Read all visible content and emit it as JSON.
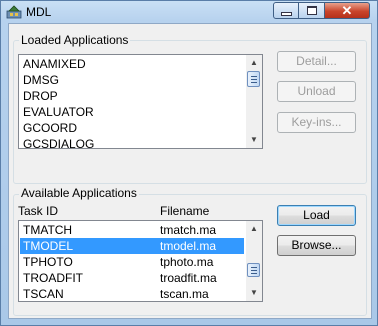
{
  "window": {
    "title": "MDL",
    "minimize_label": "",
    "maximize_label": "",
    "close_label": "✕"
  },
  "loaded": {
    "legend": "Loaded Applications",
    "items": [
      "ANAMIXED",
      "DMSG",
      "DROP",
      "EVALUATOR",
      "GCOORD",
      "GCSDIALOG"
    ]
  },
  "buttons": {
    "detail": "Detail...",
    "unload": "Unload",
    "keyins": "Key-ins...",
    "load": "Load",
    "browse": "Browse..."
  },
  "available": {
    "legend": "Available Applications",
    "col_task": "Task ID",
    "col_file": "Filename",
    "rows": [
      {
        "task": "TMATCH",
        "file": "tmatch.ma"
      },
      {
        "task": "TMODEL",
        "file": "tmodel.ma"
      },
      {
        "task": "TPHOTO",
        "file": "tphoto.ma"
      },
      {
        "task": "TROADFIT",
        "file": "troadfit.ma"
      },
      {
        "task": "TSCAN",
        "file": "tscan.ma"
      }
    ],
    "selected": "TMODEL"
  },
  "icons": {
    "app": "mdl-app-icon",
    "scroll_up": "scroll-up-arrow-icon",
    "scroll_down": "scroll-down-arrow-icon"
  }
}
